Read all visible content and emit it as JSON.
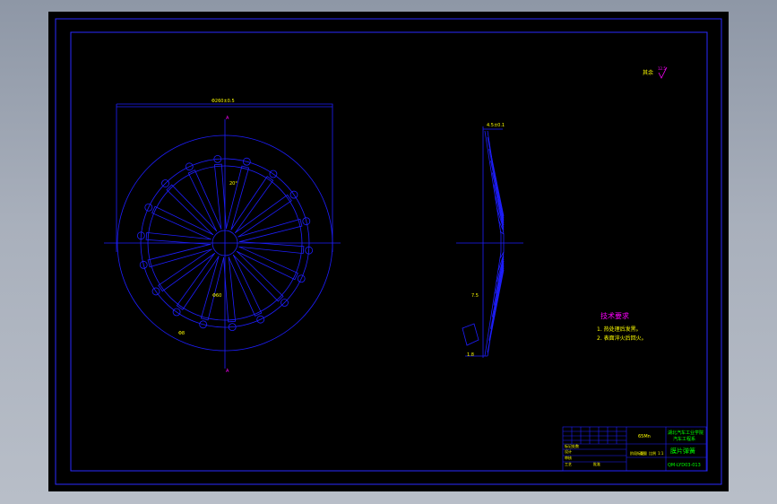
{
  "drawing": {
    "colors": {
      "background": "#000000",
      "lines": "#1e1eff",
      "frame": "#2a2aff",
      "text_yellow": "#ffff00",
      "text_green": "#00ff00",
      "text_magenta": "#ff00ff",
      "viewport_bg": "#a4acb8"
    },
    "roughness_label": "其余",
    "roughness_value": "12.5",
    "front_view": {
      "spring_fingers": 18,
      "top_dimension": "Φ260±0.5",
      "angle_note": "20°",
      "hole_note": "Φ8",
      "inner_note": "Φ60",
      "section_marker_top": "A",
      "section_marker_bottom": "A"
    },
    "side_view": {
      "top_dimension": "4.5±0.1",
      "side_note": "7.5",
      "bottom_note": "1.8"
    },
    "technical_requirements": {
      "title": "技术要求",
      "items": [
        "1. 热处理后发黑。",
        "2. 表面淬火后回火。"
      ]
    },
    "title_block": {
      "material": "65Mn",
      "school_line1": "湖北汽车工业学院",
      "school_line2": "汽车工程系",
      "part_name": "膜片弹簧",
      "drawing_number": "QM-LYD03-013",
      "rows": [
        "标记处数",
        "设计",
        "审核",
        "工艺",
        "批准"
      ],
      "stage_label": "阶段标记",
      "weight_label": "重量",
      "scale_label": "比例",
      "scale_value": "1:1"
    }
  }
}
